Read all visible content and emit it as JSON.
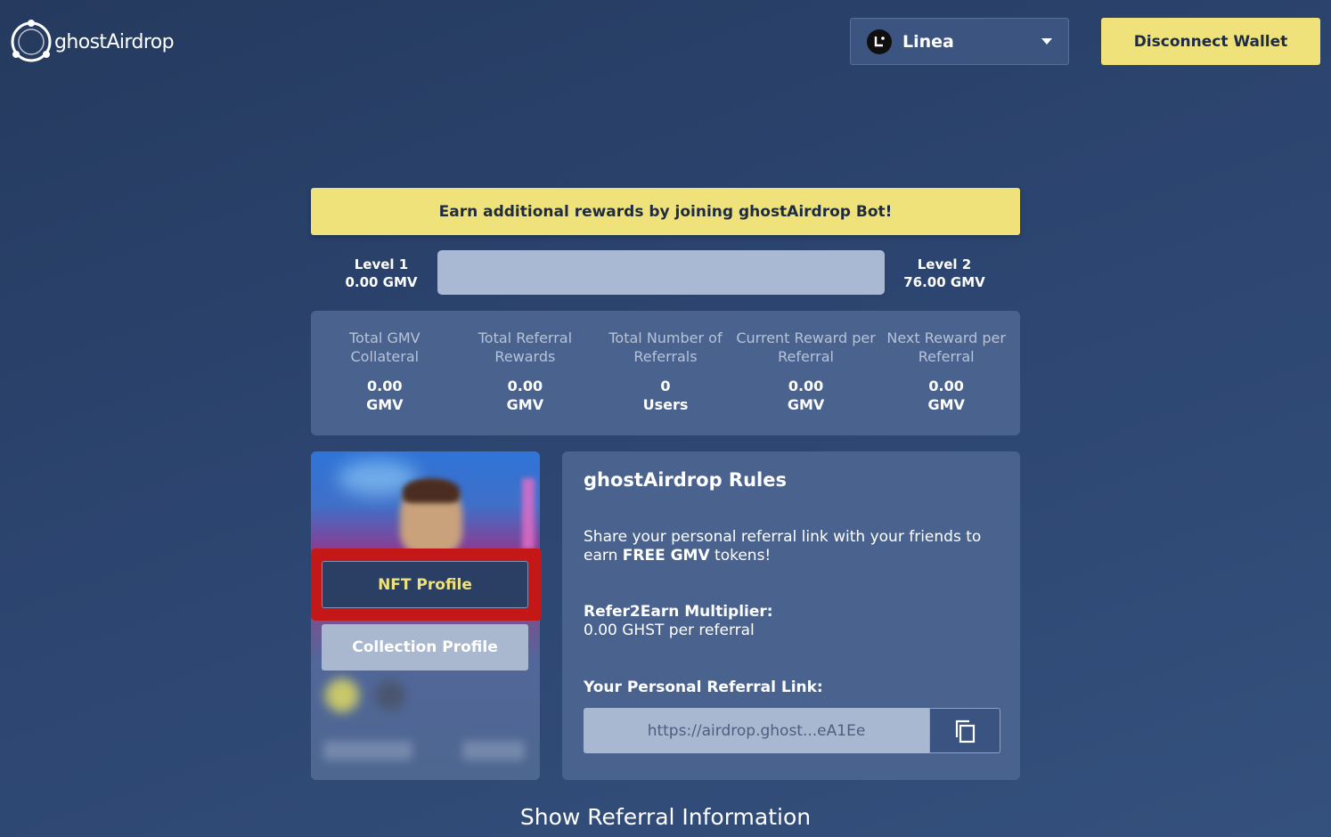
{
  "header": {
    "logo_text": "ghostAirdrop",
    "network": {
      "label": "Linea",
      "icon": "linea-icon"
    },
    "disconnect_label": "Disconnect Wallet"
  },
  "banner": {
    "text": "Earn additional rewards by joining ghostAirdrop Bot!"
  },
  "levels": {
    "current": {
      "name": "Level 1",
      "value": "0.00 GMV"
    },
    "next": {
      "name": "Level 2",
      "value": "76.00 GMV"
    },
    "progress_fraction": 0
  },
  "stats": [
    {
      "label": "Total GMV Collateral",
      "value": "0.00",
      "unit": "GMV"
    },
    {
      "label": "Total Referral Rewards",
      "value": "0.00",
      "unit": "GMV"
    },
    {
      "label": "Total Number of Referrals",
      "value": "0",
      "unit": "Users"
    },
    {
      "label": "Current Reward per Referral",
      "value": "0.00",
      "unit": "GMV"
    },
    {
      "label": "Next Reward per Referral",
      "value": "0.00",
      "unit": "GMV"
    }
  ],
  "nft_card": {
    "nft_profile_label": "NFT Profile",
    "collection_profile_label": "Collection Profile"
  },
  "rules": {
    "title": "ghostAirdrop Rules",
    "text_before": "Share your personal referral link with your friends to earn ",
    "text_bold": "FREE GMV",
    "text_after": " tokens!",
    "multiplier_label": "Refer2Earn Multiplier:",
    "multiplier_value": "0.00 GHST per referral",
    "link_label": "Your Personal Referral Link:",
    "link_value": "https://airdrop.ghost...eA1Ee"
  },
  "show_referral_label": "Show Referral Information",
  "colors": {
    "accent": "#f0e27a",
    "background": "#2c4570",
    "card": "#4a638e",
    "highlight": "#c41717"
  }
}
